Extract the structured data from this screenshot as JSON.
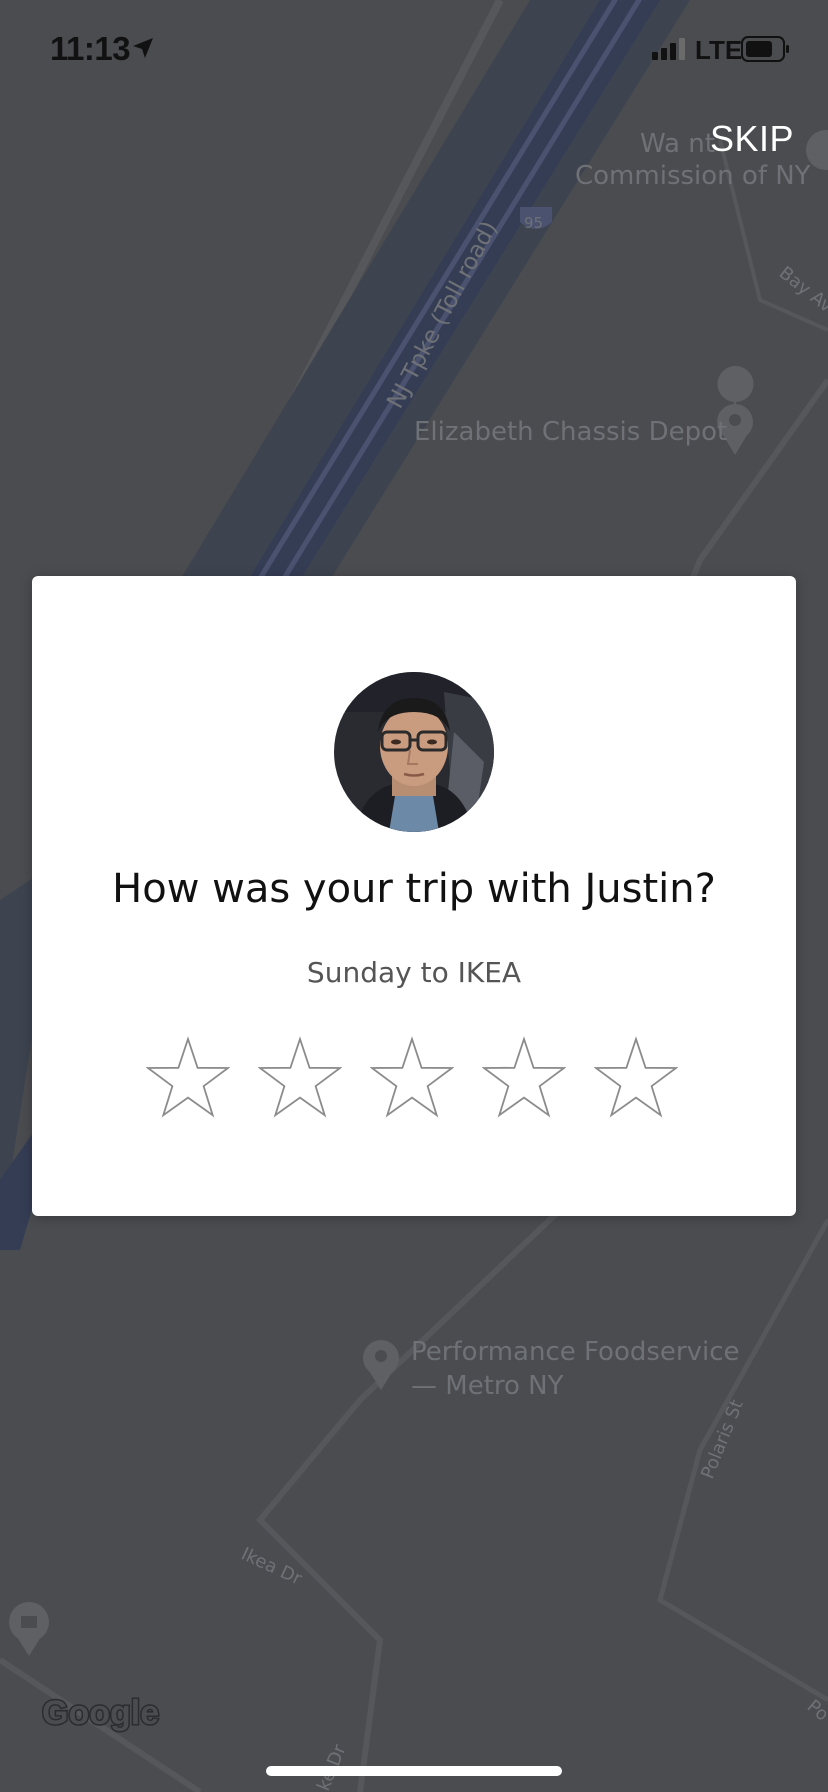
{
  "status_bar": {
    "time": "11:13",
    "network": "LTE"
  },
  "skip_label": "SKIP",
  "map": {
    "labels": {
      "commission": "Commission of NY",
      "commission_partial": "Wa      nt",
      "highway": "NJ Tpke (Toll road)",
      "interstate_shield": "95",
      "bay_ave": "Bay Av",
      "chassis_depot": "Elizabeth Chassis Depot",
      "foodservice_line1": "Performance Foodservice",
      "foodservice_line2": "— Metro NY",
      "polaris": "Polaris St",
      "ikea_dr": "Ikea Dr",
      "ikea_dr_bottom": "ke Dr",
      "po": "Po"
    },
    "attribution": "Google"
  },
  "rating_dialog": {
    "question": "How was your trip with Justin?",
    "trip_summary": "Sunday to IKEA",
    "star_count": 5,
    "selected_rating": 0
  },
  "colors": {
    "map_background": "#4b4c50",
    "highway_blue": "#3a4660",
    "card_background": "#ffffff"
  }
}
